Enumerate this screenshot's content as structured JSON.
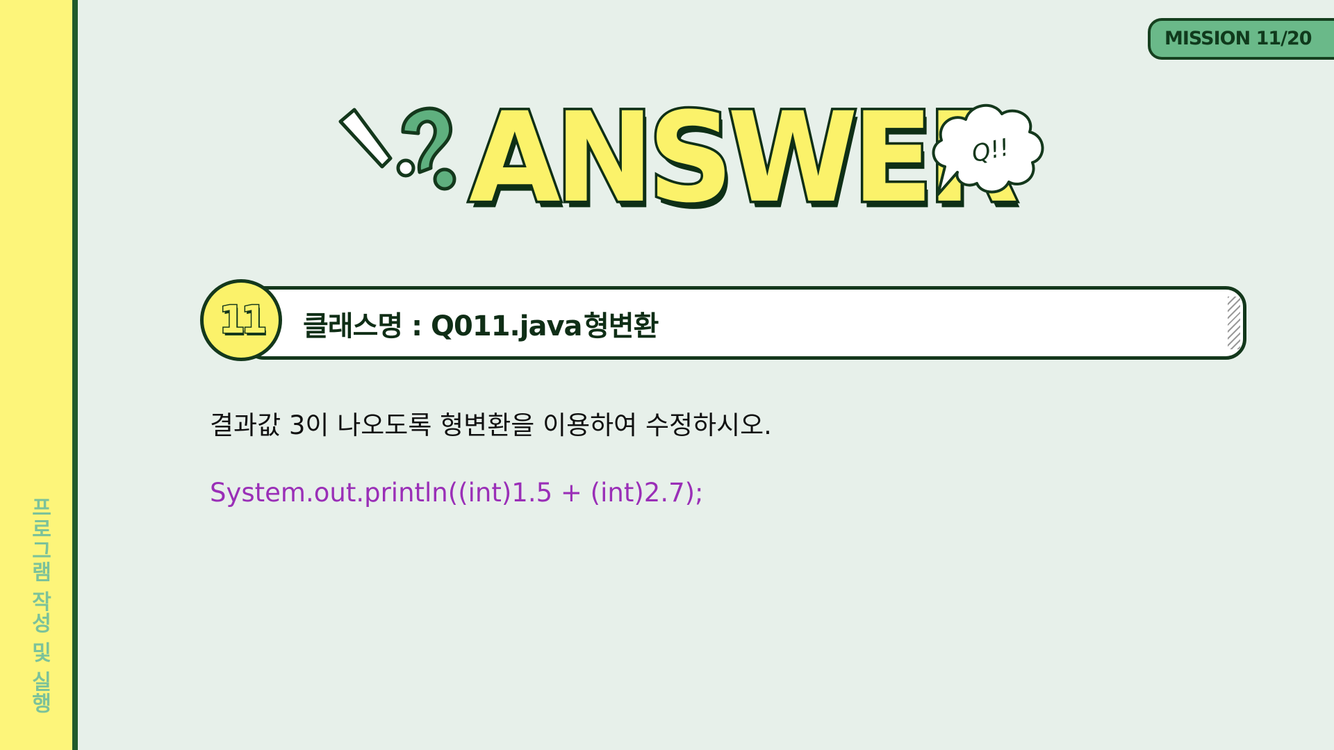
{
  "sidebar": {
    "label": "프로그램 작성 및 실행"
  },
  "mission": {
    "label": "MISSION 11/20"
  },
  "title": {
    "word": "ANSWER",
    "bubble": "Q!!"
  },
  "header": {
    "number": "11",
    "label": "클래스명 : Q011.java",
    "topic": "형변환"
  },
  "content": {
    "instruction": "결과값 3이 나오도록 형변환을 이용하여 수정하시오.",
    "code": "System.out.println((int)1.5 + (int)2.7);"
  },
  "colors": {
    "background": "#e7f0ea",
    "sidebar": "#fdf57a",
    "accent_green": "#6ab989",
    "dark_green": "#14381c",
    "title_yellow": "#fbf26a",
    "code_purple": "#9a2fb7"
  }
}
